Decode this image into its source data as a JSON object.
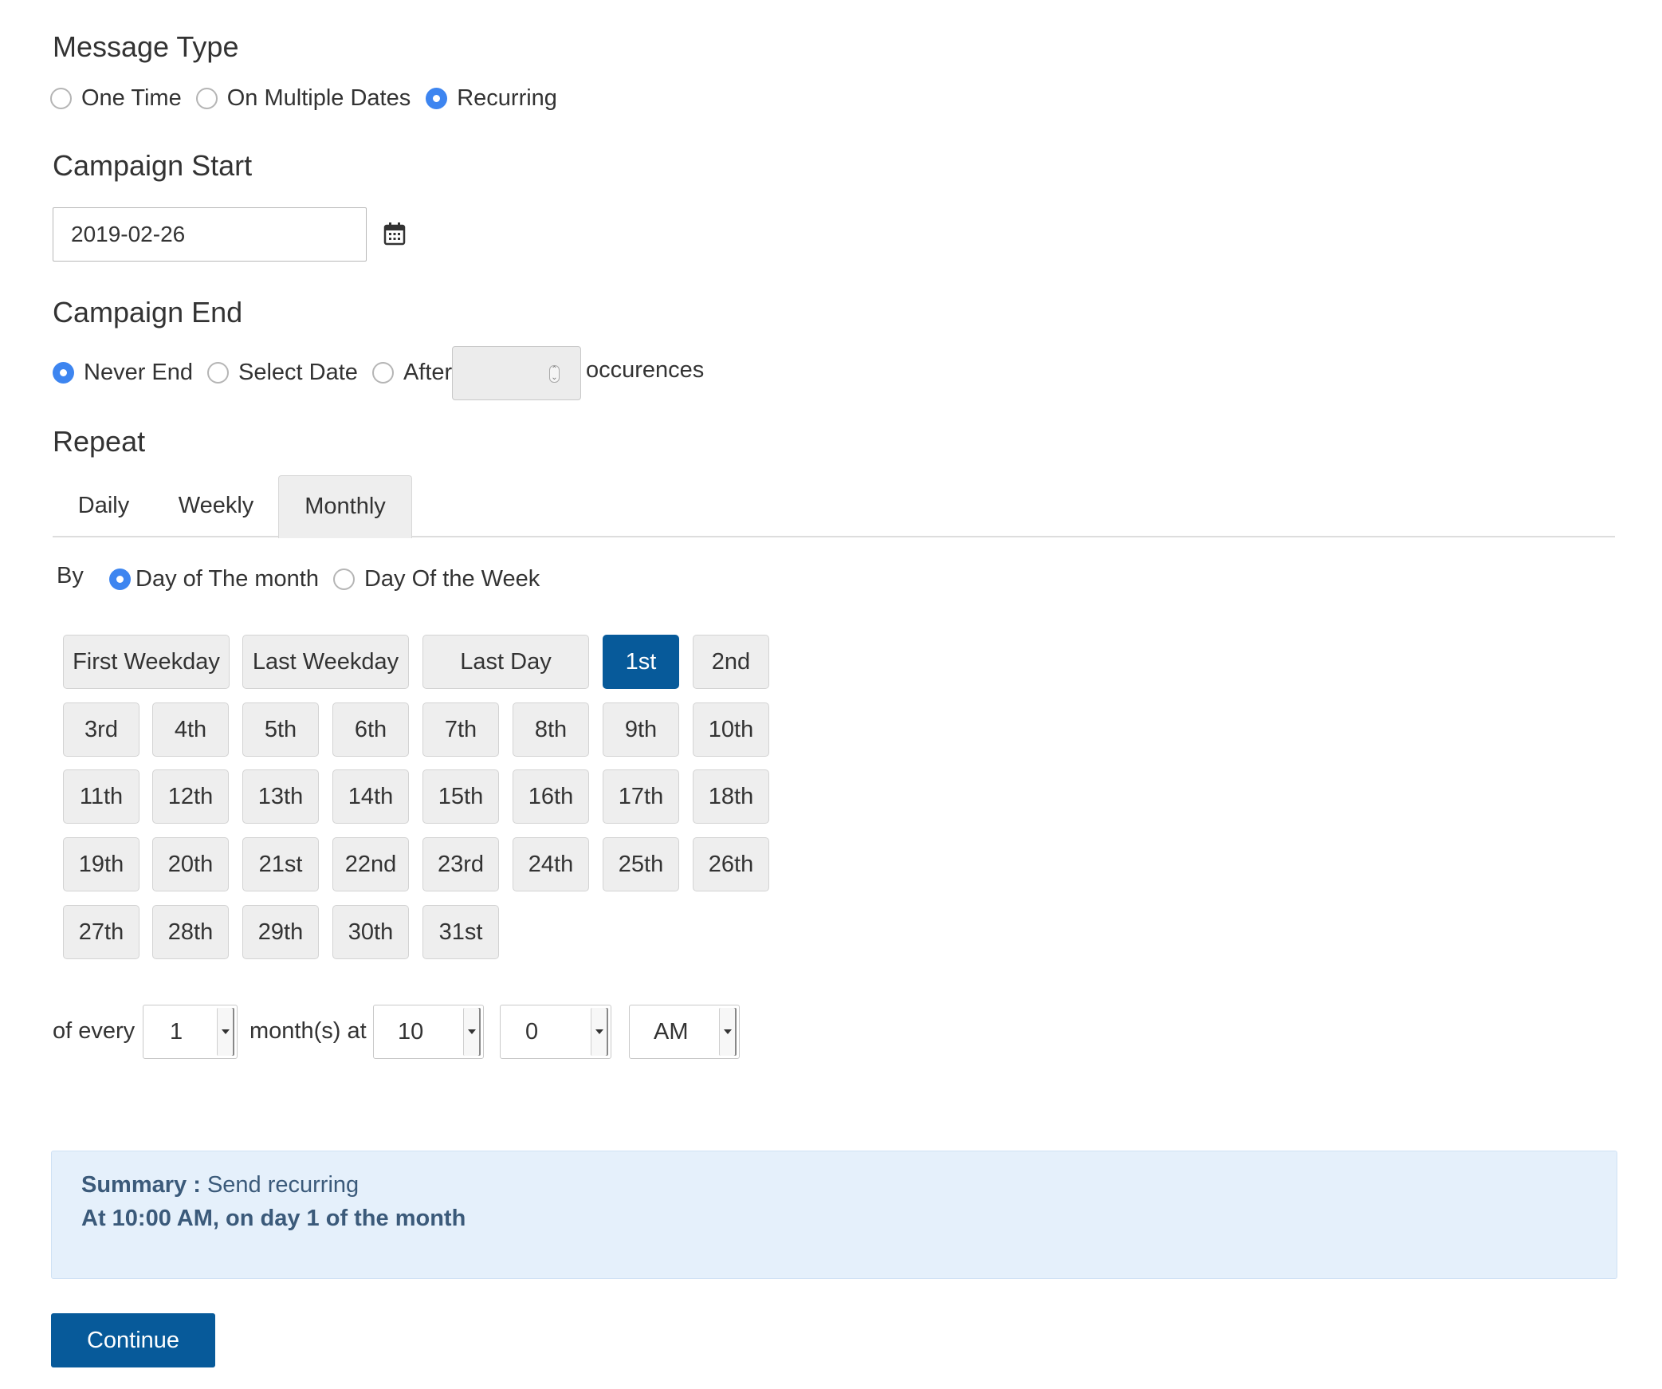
{
  "message_type": {
    "title": "Message Type",
    "options": [
      {
        "label": "One Time",
        "checked": false
      },
      {
        "label": "On Multiple Dates",
        "checked": false
      },
      {
        "label": "Recurring",
        "checked": true
      }
    ]
  },
  "campaign_start": {
    "title": "Campaign Start",
    "date_value": "2019-02-26",
    "icon": "calendar-icon"
  },
  "campaign_end": {
    "title": "Campaign End",
    "options": [
      {
        "label": "Never End",
        "checked": true
      },
      {
        "label": "Select Date",
        "checked": false
      },
      {
        "label": "After",
        "checked": false
      }
    ],
    "occurrences_value": "",
    "occurrences_label": "occurences"
  },
  "repeat": {
    "title": "Repeat",
    "tabs": [
      {
        "label": "Daily",
        "active": false
      },
      {
        "label": "Weekly",
        "active": false
      },
      {
        "label": "Monthly",
        "active": true
      }
    ],
    "by_label": "By",
    "by_options": [
      {
        "label": "Day of The month",
        "checked": true
      },
      {
        "label": "Day Of the Week",
        "checked": false
      }
    ],
    "special_days": [
      "First Weekday",
      "Last Weekday",
      "Last Day"
    ],
    "days": [
      "1st",
      "2nd",
      "3rd",
      "4th",
      "5th",
      "6th",
      "7th",
      "8th",
      "9th",
      "10th",
      "11th",
      "12th",
      "13th",
      "14th",
      "15th",
      "16th",
      "17th",
      "18th",
      "19th",
      "20th",
      "21st",
      "22nd",
      "23rd",
      "24th",
      "25th",
      "26th",
      "27th",
      "28th",
      "29th",
      "30th",
      "31st"
    ],
    "selected_day": "1st",
    "of_every_label": "of every",
    "interval_value": "1",
    "months_at_label": "month(s) at",
    "hour_value": "10",
    "minute_value": "0",
    "ampm_value": "AM"
  },
  "summary": {
    "label": "Summary :",
    "text": "Send recurring",
    "detail": "At 10:00 AM, on day 1 of the month"
  },
  "continue_label": "Continue",
  "colors": {
    "accent": "#075a9a",
    "radio_checked": "#3d85f0",
    "summary_bg": "#e5f0fb",
    "button_bg": "#eeeeee"
  }
}
